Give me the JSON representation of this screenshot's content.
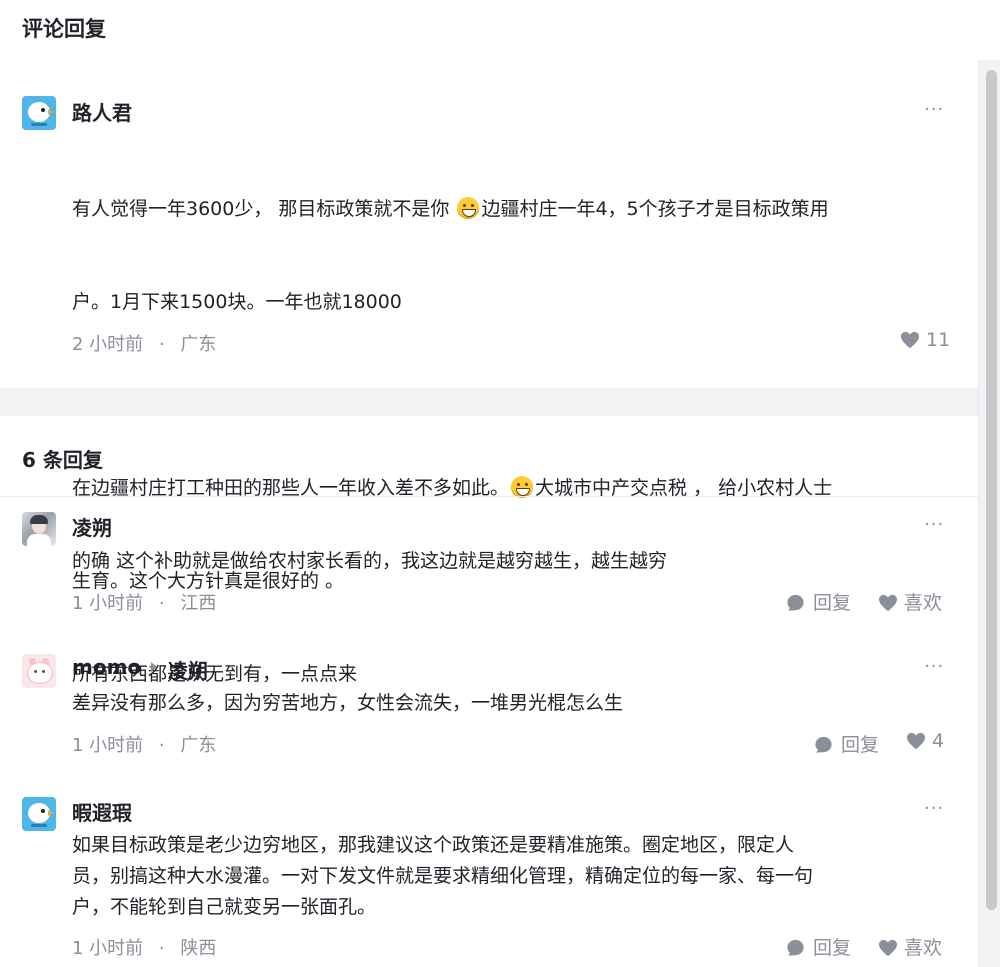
{
  "header": {
    "title": "评论回复"
  },
  "main_comment": {
    "username": "路人君",
    "avatar_icon": "bird-avatar-icon",
    "lines": [
      {
        "before": "有人觉得一年3600少， 那目标政策就不是你 ",
        "emoji": "grinning-emoji",
        "after": "边疆村庄一年4，5个孩子才是目标政策用"
      },
      {
        "before": "户。1月下来1500块。一年也就18000",
        "emoji": "",
        "after": ""
      },
      {
        "before": "",
        "emoji": "",
        "after": ""
      },
      {
        "before": "在边疆村庄打工种田的那些人一年收入差不多如此。",
        "emoji": "grinning-emoji",
        "after": "大城市中产交点税 ， 给小农村人士"
      },
      {
        "before": "生育。这个大方针真是很好的 。",
        "emoji": "",
        "after": ""
      },
      {
        "before": "所有东西都是从无到有，一点点来",
        "emoji": "",
        "after": ""
      }
    ],
    "time": "2 小时前",
    "dot": "·",
    "location": "广东",
    "likes": "11",
    "more": "···"
  },
  "replies_header": {
    "count_label": "6 条回复"
  },
  "replies": [
    {
      "username": "凌朔",
      "reply_to": "",
      "avatar_icon": "photo-avatar-icon",
      "text": "的确 这个补助就是做给农村家长看的，我这边就是越穷越生，越生越穷",
      "time": "1 小时前",
      "dot": "·",
      "location": "江西",
      "reply_label": "回复",
      "like_label": "喜欢",
      "more": "···"
    },
    {
      "username": "momo",
      "reply_to": "凌朔",
      "avatar_icon": "cute-avatar-icon",
      "text": "差异没有那么多，因为穷苦地方，女性会流失，一堆男光棍怎么生",
      "time": "1 小时前",
      "dot": "·",
      "location": "广东",
      "reply_label": "回复",
      "like_label": "4",
      "more": "···"
    },
    {
      "username": "暇遐瑕",
      "reply_to": "",
      "avatar_icon": "bird-avatar-icon",
      "text": "如果目标政策是老少边穷地区，那我建议这个政策还是要精准施策。圈定地区，限定人\n员，别搞这种大水漫灌。一对下发文件就是要求精细化管理，精确定位的每一家、每一句\n户，不能轮到自己就变另一张面孔。",
      "time": "1 小时前",
      "dot": "·",
      "location": "陕西",
      "reply_label": "回复",
      "like_label": "喜欢",
      "more": "···"
    }
  ],
  "colors": {
    "text": "#1f2329",
    "muted": "#8a8f99",
    "band": "#f3f3f5",
    "avatar_blue": "#4fb6e8"
  }
}
